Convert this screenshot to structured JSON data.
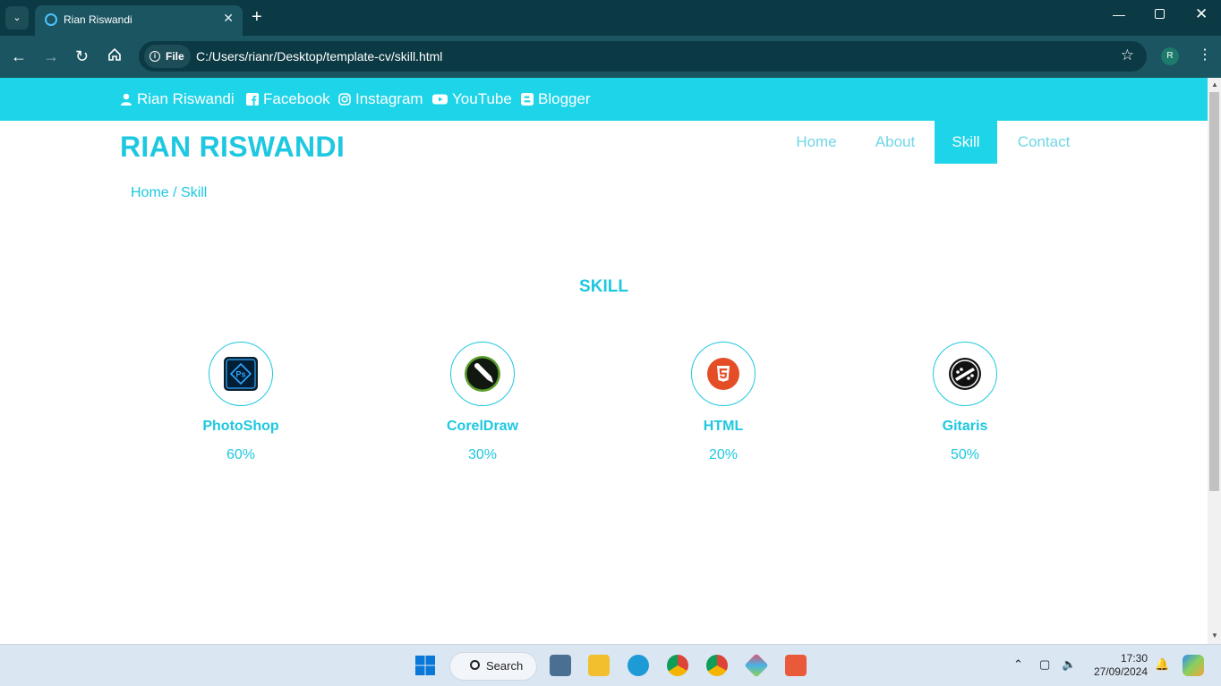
{
  "browser": {
    "tab_title": "Rian Riswandi",
    "url_scheme": "File",
    "url": "C:/Users/rianr/Desktop/template-cv/skill.html",
    "profile_initial": "R"
  },
  "topbar": {
    "name": "Rian Riswandi",
    "facebook": "Facebook",
    "instagram": "Instagram",
    "youtube": "YouTube",
    "blogger": "Blogger"
  },
  "header": {
    "brand": "RIAN RISWANDI",
    "menu": [
      {
        "label": "Home"
      },
      {
        "label": "About"
      },
      {
        "label": "Skill"
      },
      {
        "label": "Contact"
      }
    ],
    "active": "Skill"
  },
  "breadcrumb": "Home / Skill",
  "section_title": "SKILL",
  "skills": [
    {
      "name": "PhotoShop",
      "percent": "60%",
      "icon": "photoshop-icon"
    },
    {
      "name": "CorelDraw",
      "percent": "30%",
      "icon": "coreldraw-icon"
    },
    {
      "name": "HTML",
      "percent": "20%",
      "icon": "html5-icon"
    },
    {
      "name": "Gitaris",
      "percent": "50%",
      "icon": "guitar-icon"
    }
  ],
  "taskbar": {
    "search_label": "Search",
    "time": "17:30",
    "date": "27/09/2024"
  },
  "colors": {
    "accent": "#1ed4e8",
    "text_accent": "#1ec8e0",
    "chrome_dark": "#0b3a44",
    "chrome_mid": "#1a5561"
  }
}
